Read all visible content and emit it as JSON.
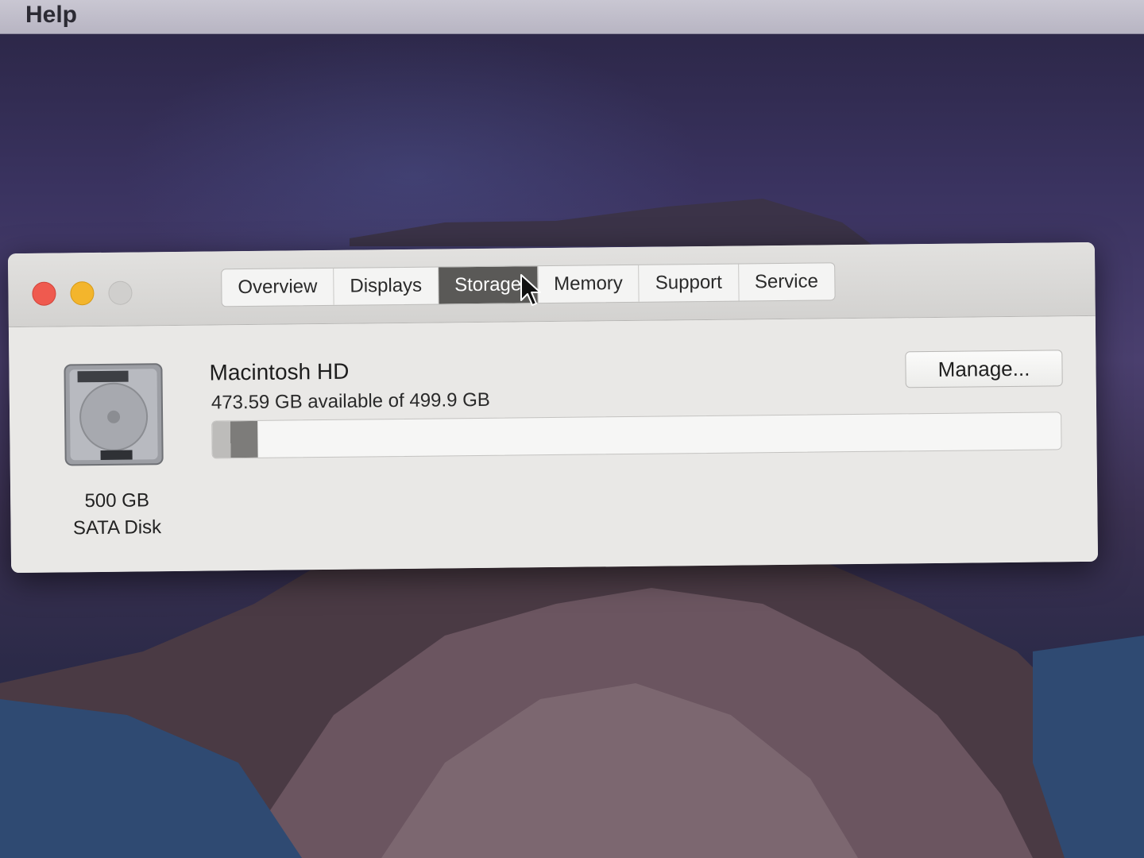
{
  "menubar": {
    "help_label": "Help"
  },
  "window": {
    "tabs": [
      {
        "label": "Overview",
        "active": false
      },
      {
        "label": "Displays",
        "active": false
      },
      {
        "label": "Storage",
        "active": true
      },
      {
        "label": "Memory",
        "active": false
      },
      {
        "label": "Support",
        "active": false
      },
      {
        "label": "Service",
        "active": false
      }
    ]
  },
  "storage": {
    "disk_capacity": "500 GB",
    "disk_type": "SATA Disk",
    "volume_name": "Macintosh HD",
    "volume_available": "473.59 GB available of 499.9 GB",
    "used_fraction": 0.053,
    "manage_label": "Manage..."
  },
  "icons": [
    "hard-disk-icon",
    "close-icon",
    "minimize-icon",
    "zoom-icon",
    "pointer-cursor-icon"
  ],
  "colors": {
    "close": "#ef5a4f",
    "minimize": "#f3b52c",
    "active_tab": "#5a5957"
  }
}
